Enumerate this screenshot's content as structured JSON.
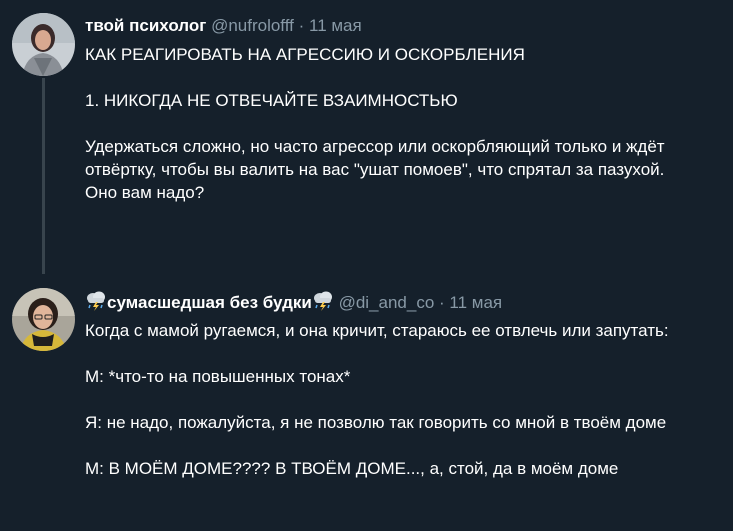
{
  "tweets": [
    {
      "display_name": "твой психолог",
      "handle": "@nufrolofff",
      "separator": "·",
      "date": "11 мая",
      "paragraphs": [
        "КАК РЕАГИРОВАТЬ НА АГРЕССИЮ И ОСКОРБЛЕНИЯ",
        "1. НИКОГДА НЕ ОТВЕЧАЙТЕ ВЗАИМНОСТЬЮ",
        "Удержаться сложно, но часто агрессор или оскорбляющий только и ждёт отвёртку, чтобы вы валить на вас \"ушат помоев\", что спрятал за пазухой. Оно вам надо?"
      ],
      "avatar_icon": "person-photo-avatar"
    },
    {
      "display_name": "сумасшедшая без будки",
      "name_emoji": "cloud-lightning-rain-icon",
      "handle": "@di_and_co",
      "separator": "·",
      "date": "11 мая",
      "paragraphs": [
        "Когда с мамой ругаемся, и она кричит, стараюсь ее отвлечь или запутать:",
        "М: *что-то на повышенных тонах*",
        "Я: не надо, пожалуйста, я не позволю так говорить со мной в твоём доме",
        "М: В МОЁМ ДОМЕ???? В ТВОЁМ ДОМЕ..., а, стой, да в моём доме"
      ],
      "avatar_icon": "person-photo-avatar"
    }
  ],
  "colors": {
    "background": "#15202b",
    "text": "#ffffff",
    "secondary_text": "#8899a6",
    "thread_line": "#38444d"
  }
}
